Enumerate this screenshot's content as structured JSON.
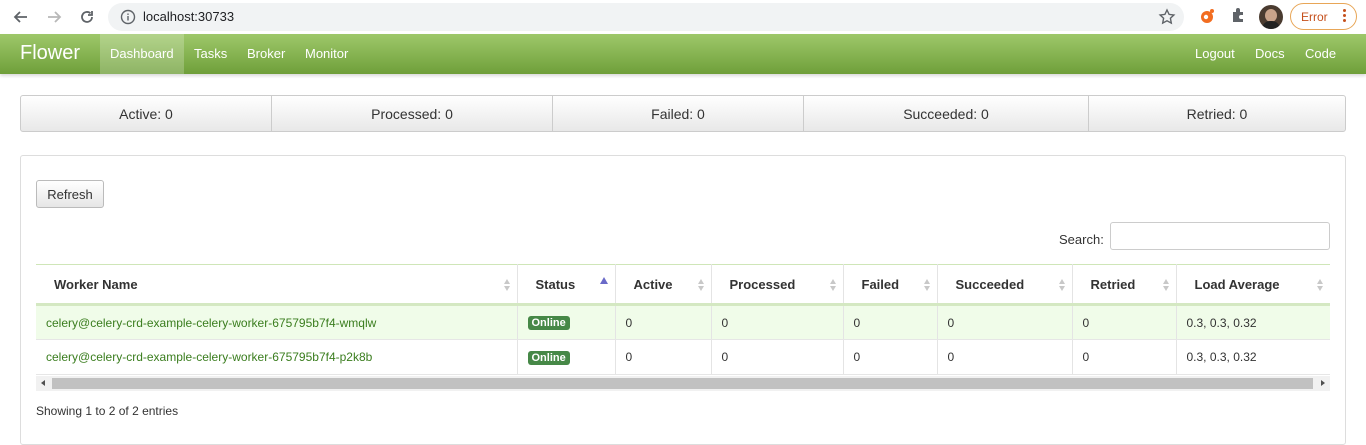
{
  "browser": {
    "url": "localhost:30733",
    "error_label": "Error"
  },
  "navbar": {
    "brand": "Flower",
    "left_links": [
      "Dashboard",
      "Tasks",
      "Broker",
      "Monitor"
    ],
    "active_link": "Dashboard",
    "right_links": [
      "Logout",
      "Docs",
      "Code"
    ],
    "gradient_colors": [
      "#9ec86a",
      "#6f9f3a"
    ]
  },
  "stats": [
    {
      "label": "Active: 0"
    },
    {
      "label": "Processed: 0"
    },
    {
      "label": "Failed: 0"
    },
    {
      "label": "Succeeded: 0"
    },
    {
      "label": "Retried: 0"
    }
  ],
  "panel": {
    "refresh_label": "Refresh",
    "search_label": "Search:",
    "search_value": "",
    "info_text": "Showing 1 to 2 of 2 entries"
  },
  "table": {
    "columns": [
      "Worker Name",
      "Status",
      "Active",
      "Processed",
      "Failed",
      "Succeeded",
      "Retried",
      "Load Average"
    ],
    "sorted_column": "Status",
    "rows": [
      {
        "worker": "celery@celery-crd-example-celery-worker-675795b7f4-wmqlw",
        "status": "Online",
        "active": "0",
        "processed": "0",
        "failed": "0",
        "succeeded": "0",
        "retried": "0",
        "load": "0.3, 0.3, 0.32"
      },
      {
        "worker": "celery@celery-crd-example-celery-worker-675795b7f4-p2k8b",
        "status": "Online",
        "active": "0",
        "processed": "0",
        "failed": "0",
        "succeeded": "0",
        "retried": "0",
        "load": "0.3, 0.3, 0.32"
      }
    ]
  },
  "colors": {
    "worker_link": "#3a7d1e",
    "online_badge": "#468847",
    "row_highlight": "#f0fce9"
  }
}
